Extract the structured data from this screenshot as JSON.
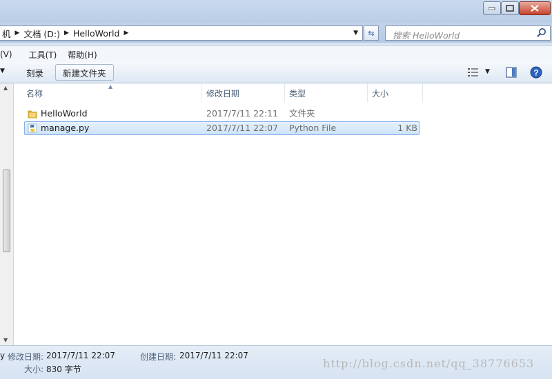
{
  "breadcrumb": {
    "items": [
      "机",
      "文档 (D:)",
      "HelloWorld"
    ]
  },
  "search": {
    "placeholder": "搜索 HelloWorld"
  },
  "menu": {
    "items": [
      "(V)",
      "工具(T)",
      "帮助(H)"
    ]
  },
  "toolbar": {
    "burn_label": "刻录",
    "new_folder_label": "新建文件夹"
  },
  "columns": [
    "名称",
    "修改日期",
    "类型",
    "大小"
  ],
  "files": [
    {
      "name": "HelloWorld",
      "date": "2017/7/11 22:11",
      "type": "文件夹",
      "size": "",
      "icon": "folder-icon"
    },
    {
      "name": "manage.py",
      "date": "2017/7/11 22:07",
      "type": "Python File",
      "size": "1 KB",
      "icon": "python-file-icon"
    }
  ],
  "details": {
    "name_fragment": "y",
    "modified_label": "修改日期:",
    "modified_value": "2017/7/11 22:07",
    "created_label": "创建日期:",
    "created_value": "2017/7/11 22:07",
    "size_label": "大小:",
    "size_value": "830 字节"
  },
  "watermark": "http://blog.csdn.net/qq_38776653",
  "colors": {
    "selection": "#cde3f9",
    "chrome": "#c3d5ec",
    "close": "#c4442c"
  }
}
